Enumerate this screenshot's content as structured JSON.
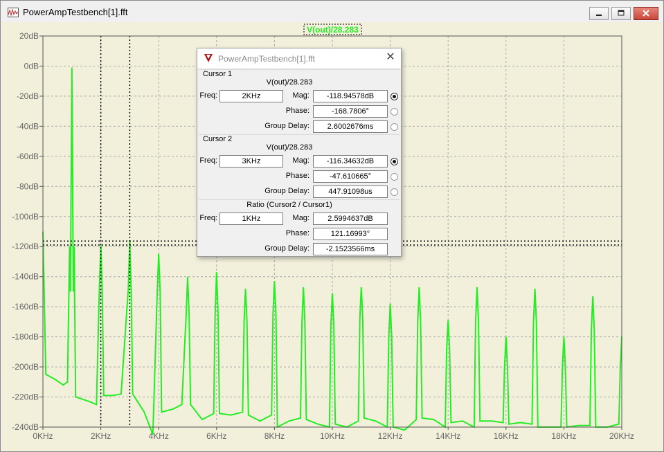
{
  "window": {
    "title": "PowerAmpTestbench[1].fft"
  },
  "plot": {
    "trace_label": "V(out)/28.283",
    "y_tick_labels": [
      "20dB",
      "0dB",
      "-20dB",
      "-40dB",
      "-60dB",
      "-80dB",
      "-100dB",
      "-120dB",
      "-140dB",
      "-160dB",
      "-180dB",
      "-200dB",
      "-220dB",
      "-240dB"
    ],
    "x_tick_labels": [
      "0KHz",
      "2KHz",
      "4KHz",
      "6KHz",
      "8KHz",
      "10KHz",
      "12KHz",
      "14KHz",
      "16KHz",
      "18KHz",
      "20KHz"
    ],
    "colors": {
      "trace": "#22ee22",
      "background": "#f2efdb",
      "grid": "#a9a9a9",
      "cursor": "#000000"
    }
  },
  "chart_data": {
    "type": "line",
    "xlim": [
      0,
      20000
    ],
    "ylim": [
      -240,
      20
    ],
    "x_unit": "Hz",
    "y_unit": "dB",
    "grid": true,
    "cursors": [
      {
        "freq": 2000,
        "mag": -118.94578
      },
      {
        "freq": 3000,
        "mag": -116.34632
      }
    ],
    "points": [
      [
        0,
        -110
      ],
      [
        100,
        -205
      ],
      [
        400,
        -208
      ],
      [
        700,
        -212
      ],
      [
        850,
        -210
      ],
      [
        920,
        -120
      ],
      [
        950,
        -150
      ],
      [
        1000,
        -1
      ],
      [
        1050,
        -150
      ],
      [
        1080,
        -120
      ],
      [
        1130,
        -220
      ],
      [
        1300,
        -221
      ],
      [
        1600,
        -223
      ],
      [
        1850,
        -225
      ],
      [
        1950,
        -148
      ],
      [
        2000,
        -119
      ],
      [
        2050,
        -150
      ],
      [
        2100,
        -219
      ],
      [
        2400,
        -219
      ],
      [
        2700,
        -218
      ],
      [
        2950,
        -148
      ],
      [
        3000,
        -116
      ],
      [
        3050,
        -150
      ],
      [
        3100,
        -218
      ],
      [
        3500,
        -230
      ],
      [
        3800,
        -245
      ],
      [
        3950,
        -150
      ],
      [
        4000,
        -125
      ],
      [
        4050,
        -150
      ],
      [
        4100,
        -230
      ],
      [
        4500,
        -228
      ],
      [
        4800,
        -225
      ],
      [
        4950,
        -165
      ],
      [
        5000,
        -140
      ],
      [
        5050,
        -165
      ],
      [
        5100,
        -225
      ],
      [
        5500,
        -235
      ],
      [
        5900,
        -231
      ],
      [
        5950,
        -165
      ],
      [
        6000,
        -137
      ],
      [
        6050,
        -165
      ],
      [
        6100,
        -231
      ],
      [
        6500,
        -232
      ],
      [
        6900,
        -230
      ],
      [
        6950,
        -170
      ],
      [
        7000,
        -148
      ],
      [
        7050,
        -170
      ],
      [
        7100,
        -232
      ],
      [
        7500,
        -236
      ],
      [
        7900,
        -232
      ],
      [
        7950,
        -165
      ],
      [
        8000,
        -143
      ],
      [
        8050,
        -165
      ],
      [
        8100,
        -240
      ],
      [
        8500,
        -236
      ],
      [
        8900,
        -234
      ],
      [
        8950,
        -170
      ],
      [
        9000,
        -147
      ],
      [
        9050,
        -170
      ],
      [
        9100,
        -235
      ],
      [
        9500,
        -238
      ],
      [
        9900,
        -240
      ],
      [
        9950,
        -172
      ],
      [
        10000,
        -151
      ],
      [
        10050,
        -172
      ],
      [
        10100,
        -238
      ],
      [
        10500,
        -240
      ],
      [
        10900,
        -236
      ],
      [
        10950,
        -168
      ],
      [
        11000,
        -147
      ],
      [
        11050,
        -168
      ],
      [
        11100,
        -234
      ],
      [
        11500,
        -236
      ],
      [
        11900,
        -240
      ],
      [
        11950,
        -180
      ],
      [
        12000,
        -158
      ],
      [
        12050,
        -180
      ],
      [
        12100,
        -240
      ],
      [
        12500,
        -242
      ],
      [
        12900,
        -235
      ],
      [
        12950,
        -170
      ],
      [
        13000,
        -147
      ],
      [
        13050,
        -170
      ],
      [
        13100,
        -234
      ],
      [
        13500,
        -235
      ],
      [
        13900,
        -240
      ],
      [
        13950,
        -188
      ],
      [
        14000,
        -169
      ],
      [
        14050,
        -188
      ],
      [
        14100,
        -237
      ],
      [
        14500,
        -236
      ],
      [
        14900,
        -240
      ],
      [
        14950,
        -170
      ],
      [
        15000,
        -147
      ],
      [
        15050,
        -170
      ],
      [
        15100,
        -236
      ],
      [
        15500,
        -236
      ],
      [
        15900,
        -237
      ],
      [
        15950,
        -200
      ],
      [
        16000,
        -180
      ],
      [
        16050,
        -200
      ],
      [
        16100,
        -238
      ],
      [
        16500,
        -237
      ],
      [
        16900,
        -238
      ],
      [
        16950,
        -170
      ],
      [
        17000,
        -148
      ],
      [
        17050,
        -170
      ],
      [
        17100,
        -240
      ],
      [
        17500,
        -240
      ],
      [
        17900,
        -240
      ],
      [
        17950,
        -200
      ],
      [
        18000,
        -180
      ],
      [
        18050,
        -200
      ],
      [
        18100,
        -240
      ],
      [
        18500,
        -239
      ],
      [
        18900,
        -239
      ],
      [
        18950,
        -175
      ],
      [
        19000,
        -153
      ],
      [
        19050,
        -175
      ],
      [
        19100,
        -240
      ],
      [
        19500,
        -240
      ],
      [
        19900,
        -238
      ],
      [
        19950,
        -200
      ],
      [
        20000,
        -180
      ]
    ]
  },
  "dialog": {
    "title": "PowerAmpTestbench[1].fft",
    "cursor1": {
      "label": "Cursor 1",
      "trace": "V(out)/28.283",
      "freq_label": "Freq:",
      "freq": "2KHz",
      "mag_label": "Mag:",
      "mag": "-118.94578dB",
      "phase_label": "Phase:",
      "phase": "-168.7806°",
      "gd_label": "Group Delay:",
      "gd": "2.6002676ms"
    },
    "cursor2": {
      "label": "Cursor 2",
      "trace": "V(out)/28.283",
      "freq_label": "Freq:",
      "freq": "3KHz",
      "mag_label": "Mag:",
      "mag": "-116.34632dB",
      "phase_label": "Phase:",
      "phase": "-47.610665°",
      "gd_label": "Group Delay:",
      "gd": "447.91098us"
    },
    "ratio": {
      "label": "Ratio (Cursor2 / Cursor1)",
      "freq_label": "Freq:",
      "freq": "1KHz",
      "mag_label": "Mag:",
      "mag": "2.5994637dB",
      "phase_label": "Phase:",
      "phase": "121.16993°",
      "gd_label": "Group Delay:",
      "gd": "-2.1523566ms"
    }
  }
}
